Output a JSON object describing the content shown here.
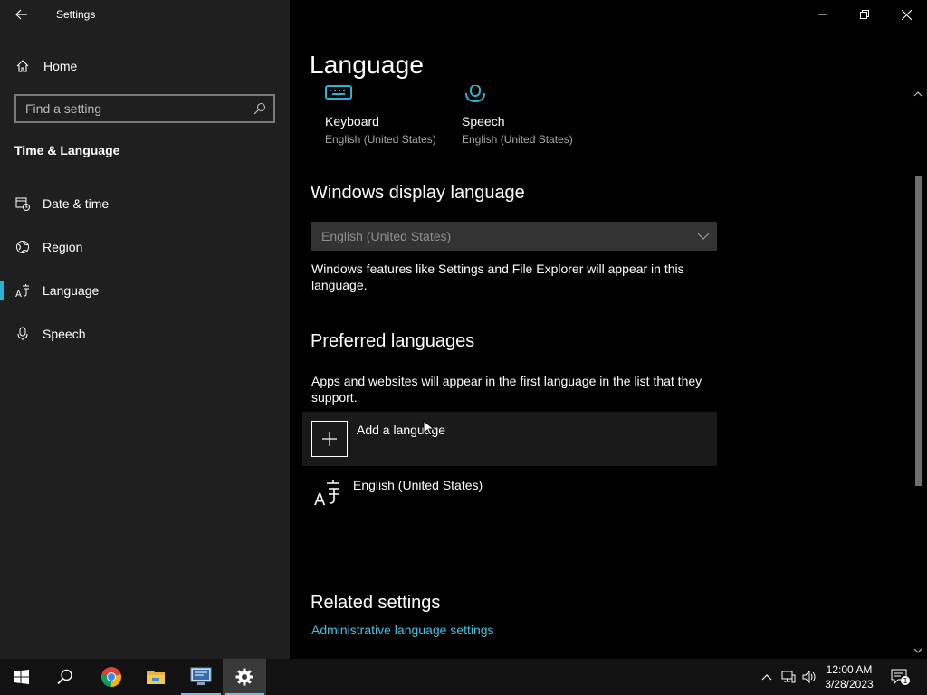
{
  "window": {
    "title": "Settings"
  },
  "sidebar": {
    "home_label": "Home",
    "search_placeholder": "Find a setting",
    "section_title": "Time & Language",
    "items": [
      {
        "label": "Date & time",
        "icon": "date-time-icon"
      },
      {
        "label": "Region",
        "icon": "globe-icon"
      },
      {
        "label": "Language",
        "icon": "language-icon",
        "active": true
      },
      {
        "label": "Speech",
        "icon": "microphone-icon"
      }
    ]
  },
  "main": {
    "page_title": "Language",
    "tiles": [
      {
        "name": "Keyboard",
        "sub": "English (United States)",
        "icon": "keyboard-icon"
      },
      {
        "name": "Speech",
        "sub": "English (United States)",
        "icon": "microphone-icon"
      }
    ],
    "display_language": {
      "heading": "Windows display language",
      "selected": "English (United States)",
      "description": "Windows features like Settings and File Explorer will appear in this language."
    },
    "preferred": {
      "heading": "Preferred languages",
      "description": "Apps and websites will appear in the first language in the list that they support.",
      "add_label": "Add a language",
      "languages": [
        "English (United States)"
      ]
    },
    "related": {
      "heading": "Related settings",
      "link": "Administrative language settings"
    }
  },
  "taskbar": {
    "apps": [
      "start-icon",
      "search-icon",
      "chrome-icon",
      "file-explorer-icon",
      "desktop-app-icon",
      "settings-icon"
    ],
    "time": "12:00 AM",
    "date": "3/28/2023",
    "notification_count": "1"
  },
  "colors": {
    "accent": "#2bb3d6",
    "link": "#4cc2e6",
    "sidebar_bg": "#1f1f1f",
    "main_bg": "#000000"
  }
}
